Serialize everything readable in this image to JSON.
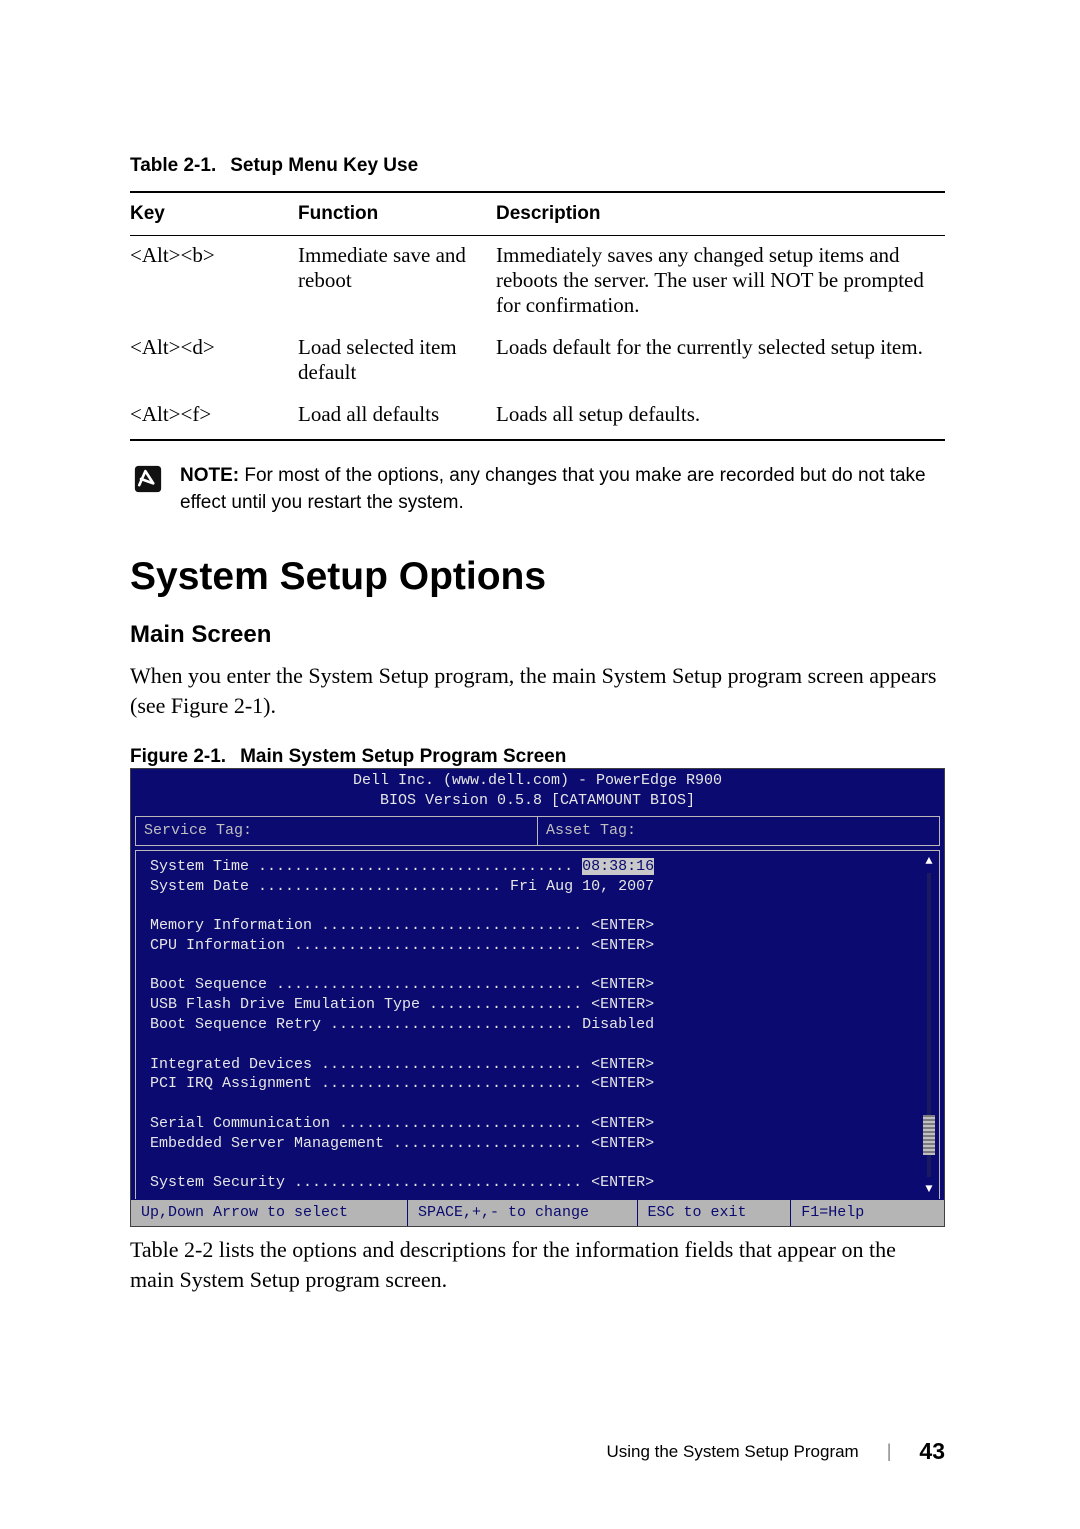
{
  "table_caption": {
    "label": "Table 2-1.",
    "title": "Setup Menu Key Use"
  },
  "table_headers": {
    "key": "Key",
    "func": "Function",
    "desc": "Description"
  },
  "table_rows": [
    {
      "key": "<Alt><b>",
      "func": "Immediate save and reboot",
      "desc": "Immediately saves any changed setup items and reboots the server. The user will NOT be prompted for confirmation."
    },
    {
      "key": "<Alt><d>",
      "func": "Load selected item default",
      "desc": "Loads default for the currently selected setup item."
    },
    {
      "key": "<Alt><f>",
      "func": "Load all defaults",
      "desc": "Loads all setup defaults."
    }
  ],
  "note": {
    "label": "NOTE:",
    "text": " For most of the options, any changes that you make are recorded but do not take effect until you restart the system."
  },
  "heading": "System Setup Options",
  "subheading": "Main Screen",
  "intro_para": "When you enter the System Setup program, the main System Setup program screen appears (see Figure 2-1).",
  "figure_caption": {
    "label": "Figure 2-1.",
    "title": "Main System Setup Program Screen"
  },
  "bios": {
    "header_line1": "Dell Inc. (www.dell.com) - PowerEdge R900",
    "header_line2": "BIOS Version 0.5.8 [CATAMOUNT BIOS]",
    "service_tag_label": "Service Tag:",
    "asset_tag_label": "Asset Tag:",
    "rows": [
      {
        "label": "System Time",
        "value": "08:38:16",
        "hl": true
      },
      {
        "label": "System Date",
        "value": "Fri Aug 10, 2007"
      },
      {
        "gap": true
      },
      {
        "label": "Memory Information",
        "value": "<ENTER>"
      },
      {
        "label": "CPU Information",
        "value": "<ENTER>"
      },
      {
        "gap": true
      },
      {
        "label": "Boot Sequence",
        "value": "<ENTER>"
      },
      {
        "label": "USB Flash Drive Emulation Type",
        "value": "<ENTER>"
      },
      {
        "label": "Boot Sequence Retry",
        "value": "Disabled"
      },
      {
        "gap": true
      },
      {
        "label": "Integrated Devices",
        "value": "<ENTER>"
      },
      {
        "label": "PCI IRQ Assignment",
        "value": "<ENTER>"
      },
      {
        "gap": true
      },
      {
        "label": "Serial Communication",
        "value": "<ENTER>"
      },
      {
        "label": "Embedded Server Management",
        "value": "<ENTER>"
      },
      {
        "gap": true
      },
      {
        "label": "System Security",
        "value": "<ENTER>"
      }
    ],
    "help": {
      "nav": "Up,Down Arrow to select",
      "change": "SPACE,+,- to change",
      "exit": "ESC to exit",
      "help": "F1=Help"
    }
  },
  "after_fig": "Table 2-2 lists the options and descriptions for the information fields that appear on the main System Setup program screen.",
  "footer": {
    "section": "Using the System Setup Program",
    "page": "43"
  }
}
